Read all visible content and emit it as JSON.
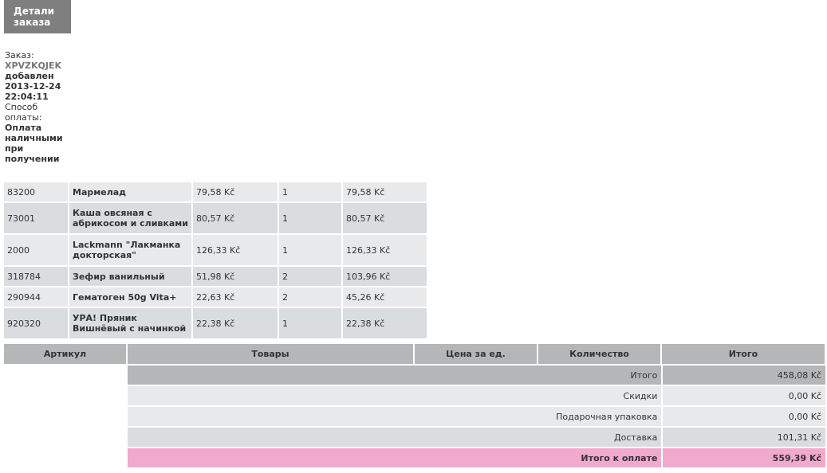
{
  "header": {
    "tab_title": "Детали заказа"
  },
  "order": {
    "order_label": "Заказ:",
    "order_code": "XPVZKQJEK",
    "added_label": "добавлен",
    "added_date": "2013-12-24 22:04:11",
    "payment_label": "Способ оплаты:",
    "payment_method": "Оплата наличными при получении"
  },
  "items": [
    {
      "sku": "83200",
      "name": "Мармелад",
      "price": "79,58 Kč",
      "qty": "1",
      "total": "79,58 Kč"
    },
    {
      "sku": "73001",
      "name": "Каша овсяная с абрикосом и сливками",
      "price": "80,57 Kč",
      "qty": "1",
      "total": "80,57 Kč"
    },
    {
      "sku": "2000",
      "name": "Lackmann \"Лакманка докторская\"",
      "price": "126,33 Kč",
      "qty": "1",
      "total": "126,33 Kč"
    },
    {
      "sku": "318784",
      "name": "Зефир ванильный",
      "price": "51,98 Kč",
      "qty": "2",
      "total": "103,96 Kč"
    },
    {
      "sku": "290944",
      "name": "Гематоген 50g Vita+",
      "price": "22,63 Kč",
      "qty": "2",
      "total": "45,26 Kč"
    },
    {
      "sku": "920320",
      "name": "УРА! Пряник Вишнёвый с начинкой",
      "price": "22,38 Kč",
      "qty": "1",
      "total": "22,38 Kč"
    }
  ],
  "columns": {
    "sku": "Артикул",
    "goods": "Товары",
    "unit_price": "Цена за ед.",
    "quantity": "Количество",
    "total": "Итого"
  },
  "totals": [
    {
      "label": "Итого",
      "value": "458,08 Kč"
    },
    {
      "label": "Скидки",
      "value": "0,00 Kč"
    },
    {
      "label": "Подарочная упаковка",
      "value": "0,00 Kč"
    },
    {
      "label": "Доставка",
      "value": "101,31 Kč"
    },
    {
      "label": "Итого к оплате",
      "value": "559,39 Kč"
    }
  ],
  "colors": {
    "tab_bg": "#7f7f7f",
    "header_bg": "#b5b6b8",
    "row_light": "#e8e9ea",
    "row_dark": "#d9dde0",
    "grand_total_bg": "#f2a9ce"
  }
}
